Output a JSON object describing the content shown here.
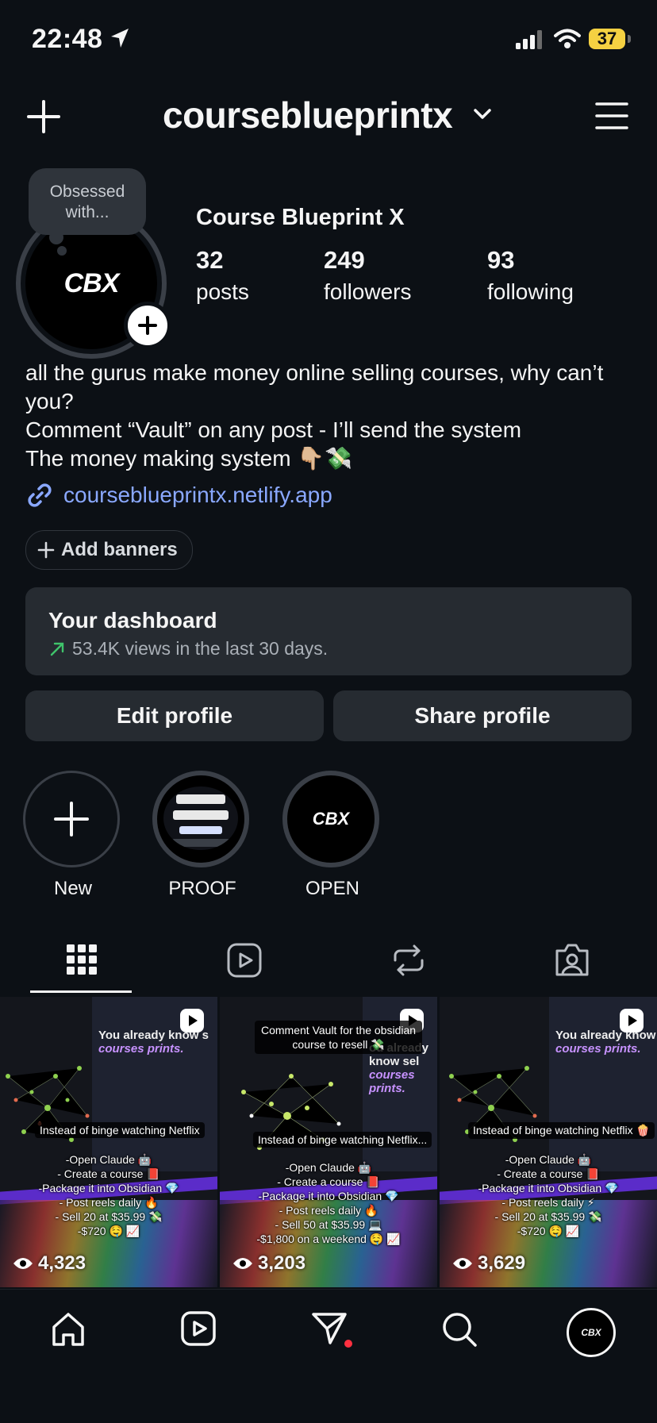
{
  "status_bar": {
    "time": "22:48",
    "battery": "37"
  },
  "header": {
    "username": "courseblueprintx"
  },
  "profile": {
    "note": "Obsessed with...",
    "avatar_text": "CBX",
    "display_name": "Course Blueprint X",
    "stats": [
      {
        "value": "32",
        "label": "posts"
      },
      {
        "value": "249",
        "label": "followers"
      },
      {
        "value": "93",
        "label": "following"
      }
    ],
    "bio_lines": [
      "all the gurus make money online selling courses, why can’t",
      "you?",
      "Comment “Vault” on any post - I’ll send the system",
      "The money making system 👇🏼💸"
    ],
    "link": "courseblueprintx.netlify.app",
    "add_banners": "Add banners"
  },
  "dashboard": {
    "title": "Your dashboard",
    "subtitle": "53.4K views in the last 30 days."
  },
  "actions": {
    "edit": "Edit profile",
    "share": "Share profile"
  },
  "highlights": [
    {
      "label": "New"
    },
    {
      "label": "PROOF"
    },
    {
      "label": "OPEN",
      "logo": "CBX"
    }
  ],
  "tabs": [
    "grid-icon",
    "reels-icon",
    "reposts-icon",
    "tagged-icon"
  ],
  "posts": [
    {
      "headline_a": "You already know s",
      "headline_b": "courses prints.",
      "caption": "Instead of binge watching Netflix",
      "list": [
        "-Open Claude 🤖",
        "- Create a course 📕",
        "-Package it into Obsidian 💎",
        "- Post reels daily 🔥",
        "- Sell 20 at $35.99 💸",
        "-$720 🤤 📈"
      ],
      "views": "4,323"
    },
    {
      "top_caption": [
        "Comment Vault for the obsidian",
        "course to resell 💸"
      ],
      "headline_a": "ou already know sel",
      "headline_b": "courses prints.",
      "caption": "Instead of binge watching Netflix...",
      "list": [
        "-Open Claude 🤖",
        "- Create a course 📕",
        "-Package it into Obsidian 💎",
        "- Post reels daily 🔥",
        "- Sell 50 at $35.99 💻",
        "-$1,800 on a weekend 🤤 📈"
      ],
      "views": "3,203"
    },
    {
      "headline_a": "You already know",
      "headline_b": "courses prints.",
      "caption": "Instead of binge watching Netflix 🍿",
      "list": [
        "-Open Claude 🤖",
        "- Create a course 📕",
        "-Package it into Obsidian 💎",
        "- Post reels daily ⚡",
        "- Sell 20 at $35.99 💸",
        "-$720 🤤 📈"
      ],
      "views": "3,629"
    }
  ],
  "bottom_nav": {
    "avatar_text": "CBX"
  }
}
